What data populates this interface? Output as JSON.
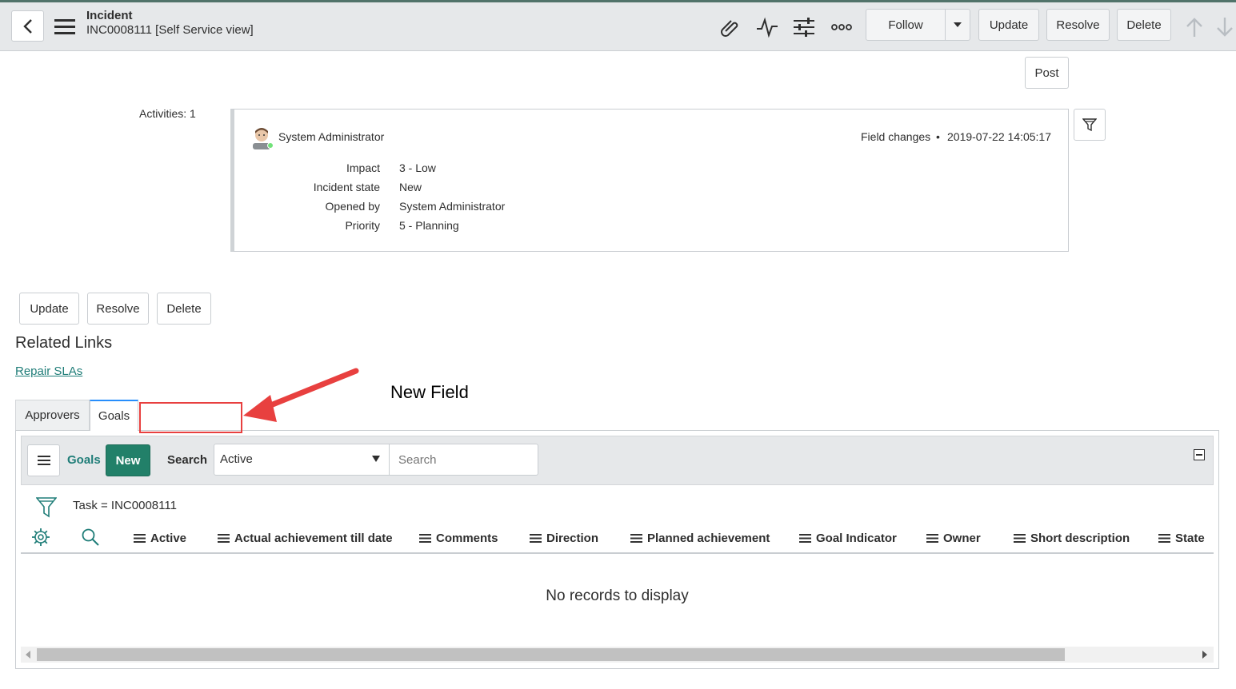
{
  "header": {
    "title": "Incident",
    "subtitle": "INC0008111 [Self Service view]",
    "buttons": {
      "follow": "Follow",
      "update": "Update",
      "resolve": "Resolve",
      "delete": "Delete"
    }
  },
  "post_label": "Post",
  "activities": {
    "label": "Activities: 1",
    "entry": {
      "user": "System Administrator",
      "type": "Field changes",
      "separator": "•",
      "timestamp": "2019-07-22 14:05:17",
      "fields": [
        {
          "label": "Impact",
          "value": "3 - Low"
        },
        {
          "label": "Incident state",
          "value": "New"
        },
        {
          "label": "Opened by",
          "value": "System Administrator"
        },
        {
          "label": "Priority",
          "value": "5 - Planning"
        }
      ]
    }
  },
  "bottom_buttons": {
    "update": "Update",
    "resolve": "Resolve",
    "delete": "Delete"
  },
  "related_links": {
    "heading": "Related Links",
    "link": "Repair SLAs"
  },
  "annotation": {
    "text": "New Field"
  },
  "tabs": [
    {
      "label": "Approvers"
    },
    {
      "label": "Goals"
    }
  ],
  "list": {
    "title": "Goals",
    "new_label": "New",
    "search_label": "Search",
    "filter_select": "Active",
    "search_placeholder": "Search",
    "breadcrumb": "Task = INC0008111",
    "columns": [
      "Active",
      "Actual achievement till date",
      "Comments",
      "Direction",
      "Planned achievement",
      "Goal Indicator",
      "Owner",
      "Short description",
      "State"
    ],
    "empty_message": "No records to display"
  },
  "colors": {
    "accent": "#278efc",
    "brand_green": "#1f7d78",
    "new_button": "#228069",
    "annotation_red": "#e8403f"
  }
}
